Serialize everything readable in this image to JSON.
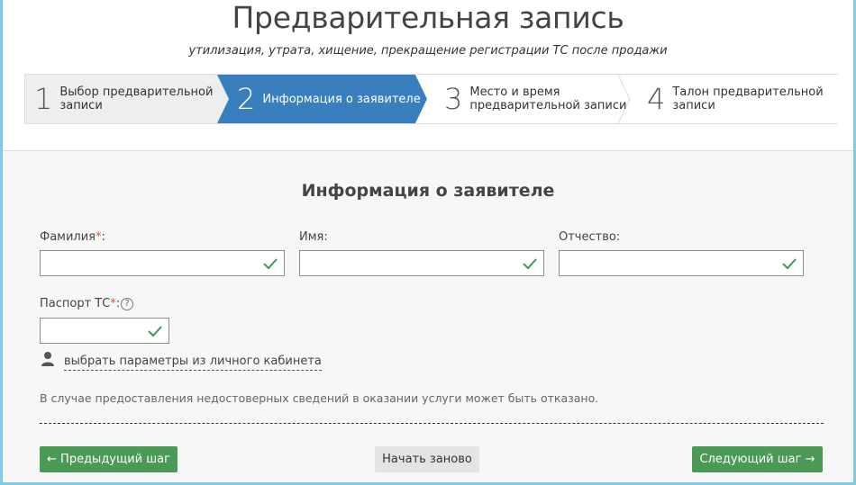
{
  "header": {
    "title": "Предварительная запись",
    "subtitle": "утилизация, утрата, хищение, прекращение регистрации ТС после продажи"
  },
  "steps": [
    {
      "num": "1",
      "line1": "Выбор предварительной",
      "line2": "записи"
    },
    {
      "num": "2",
      "line1": "Информация о заявителе",
      "line2": ""
    },
    {
      "num": "3",
      "line1": "Место и время",
      "line2": "предварительной записи"
    },
    {
      "num": "4",
      "line1": "Талон предварительной",
      "line2": "записи"
    }
  ],
  "form": {
    "section_title": "Информация о заявителе",
    "surname_label": "Фамилия",
    "name_label": "Имя:",
    "patronymic_label": "Отчество:",
    "passport_label": "Паспорт ТС",
    "required_mark": "*",
    "colon": ":",
    "help": "?",
    "cabinet_link": "выбрать параметры из личного кабинета",
    "notice": "В случае предоставления недостоверных сведений в оказании услуги может быть отказано."
  },
  "buttons": {
    "prev": "← Предыдущий шаг",
    "restart": "Начать заново",
    "next": "Следующий шаг →"
  },
  "colors": {
    "active_step": "#3a7fbd",
    "check": "#3f9a4d",
    "button_green": "#4a9a55"
  }
}
